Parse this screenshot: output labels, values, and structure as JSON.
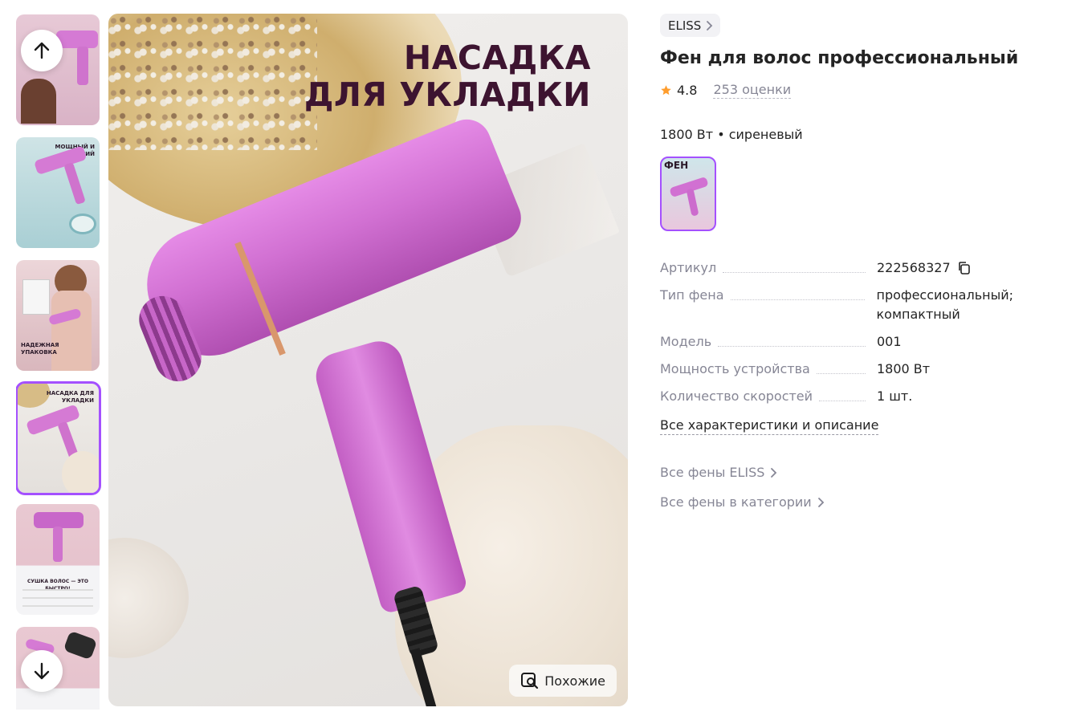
{
  "gallery": {
    "thumbnails": [
      {
        "caption": "",
        "caption_pos": "top"
      },
      {
        "caption": "Мощный и тихий",
        "caption_pos": "top"
      },
      {
        "caption": "Надежная упаковка",
        "caption_pos": "bottom"
      },
      {
        "caption": "Насадка для укладки",
        "caption_pos": "top"
      },
      {
        "caption": "Сушка волос — это быстро!",
        "caption_pos": "bottom"
      },
      {
        "caption": "",
        "caption_pos": "top"
      }
    ],
    "active_index": 3,
    "main_headline_line1": "НАСАДКА",
    "main_headline_line2": "ДЛЯ УКЛАДКИ",
    "similar_button_label": "Похожие",
    "accent_color": "#a450ff",
    "product_color": "#d170d2"
  },
  "product": {
    "brand": "ELISS",
    "title": "Фен для волос профессиональный",
    "rating": "4.8",
    "reviews": "253 оценки",
    "variant_label": "1800 Вт • сиреневый",
    "variant_thumb_caption": "ФЕН"
  },
  "specs": [
    {
      "key": "Артикул",
      "value": "222568327",
      "copyable": true
    },
    {
      "key": "Тип фена",
      "value": "профессиональный; компактный",
      "copyable": false
    },
    {
      "key": "Модель",
      "value": "001",
      "copyable": false
    },
    {
      "key": "Мощность устройства",
      "value": "1800 Вт",
      "copyable": false
    },
    {
      "key": "Количество скоростей",
      "value": "1 шт.",
      "copyable": false
    }
  ],
  "links": {
    "all_specs": "Все характеристики и описание",
    "all_brand": "Все фены ELISS",
    "all_category": "Все фены в категории"
  },
  "icons": {
    "up": "arrow-up-icon",
    "down": "arrow-down-icon",
    "star": "star-icon",
    "copy": "copy-icon",
    "chevron": "chevron-right-icon",
    "similar": "image-search-icon"
  }
}
